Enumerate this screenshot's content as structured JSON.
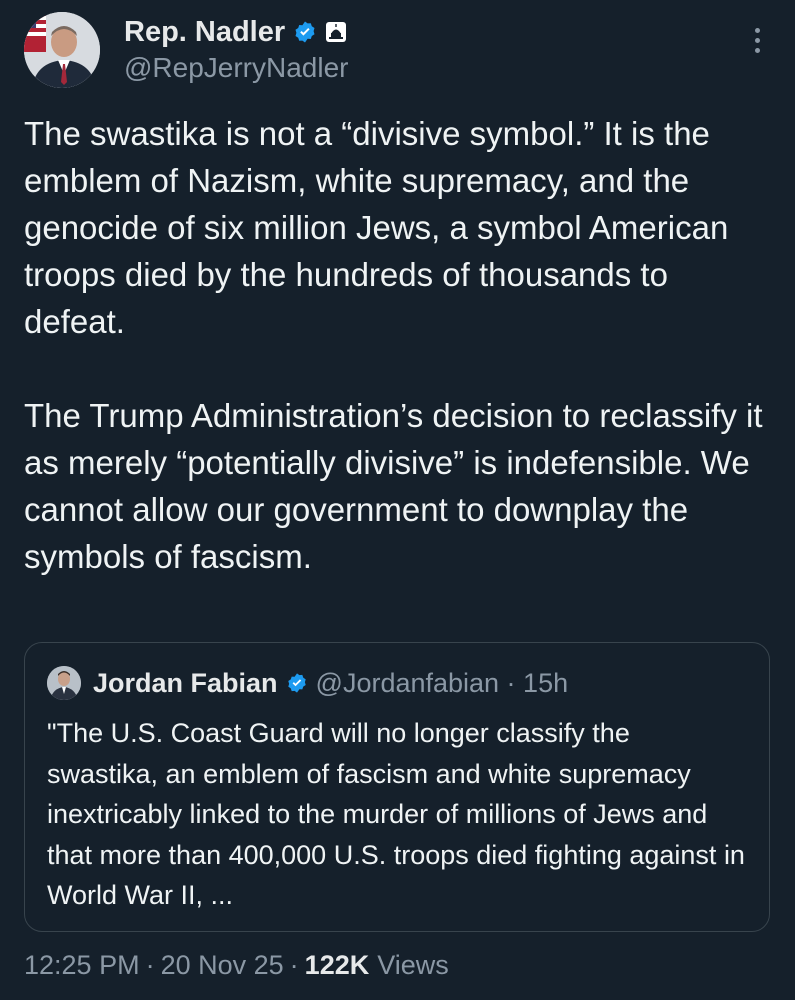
{
  "author": {
    "display_name": "Rep. Nadler",
    "handle": "@RepJerryNadler"
  },
  "tweet": {
    "paragraphs": [
      "The swastika is not a “divisive symbol.” It is the emblem of Nazism, white supremacy, and the genocide of six million Jews, a symbol American troops died by the hundreds of thousands to defeat.",
      "The Trump Administration’s decision to reclassify it as merely “potentially divisive” is indefensible. We cannot allow our government to downplay the symbols of fascism."
    ]
  },
  "quoted_tweet": {
    "display_name": "Jordan Fabian",
    "handle_time": "@Jordanfabian · 15h",
    "text": "\"The U.S. Coast Guard will no longer classify the swastika, an emblem of fascism and white supremacy inextricably linked to the murder of millions of Jews and that more than 400,000 U.S. troops died fighting against in World War II, ..."
  },
  "meta": {
    "time": "12:25 PM",
    "date": "20 Nov 25",
    "separator": "·",
    "views_count": "122K",
    "views_label": "Views"
  },
  "colors": {
    "background": "#15202b",
    "verified": "#1d9bf0",
    "secondary_text": "#8b98a5"
  },
  "icons": {
    "verified": "verified-badge-icon",
    "government": "capitol-badge-icon",
    "more": "more-options-icon"
  }
}
